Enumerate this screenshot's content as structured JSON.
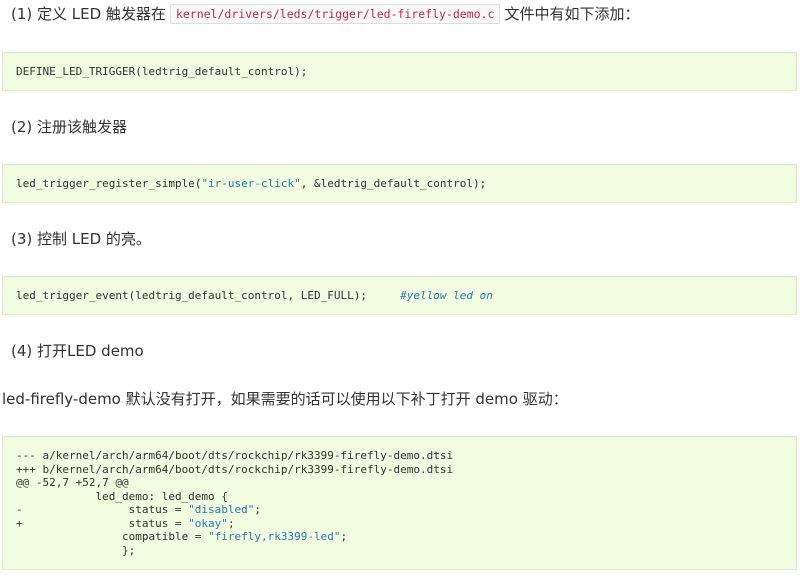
{
  "step1": {
    "prefix": "(1) 定义 LED 触发器在",
    "path": "kernel/drivers/leds/trigger/led-firefly-demo.c",
    "suffix": "文件中有如下添加："
  },
  "code1": "DEFINE_LED_TRIGGER(ledtrig_default_control);",
  "step2": "(2) 注册该触发器",
  "code2": {
    "before": "led_trigger_register_simple(",
    "string": "\"ir-user-click\"",
    "after": ", &ledtrig_default_control);"
  },
  "step3": "(3) 控制 LED 的亮。",
  "code3": {
    "code": "led_trigger_event(ledtrig_default_control, LED_FULL);     ",
    "comment": "#yellow led on"
  },
  "step4": "(4) 打开LED demo",
  "note": "led-firefly-demo 默认没有打开，如果需要的话可以使用以下补丁打开 demo 驱动：",
  "patch": {
    "line1": "--- a/kernel/arch/arm64/boot/dts/rockchip/rk3399-firefly-demo.dtsi",
    "line2": "+++ b/kernel/arch/arm64/boot/dts/rockchip/rk3399-firefly-demo.dtsi",
    "line3": "@@ -52,7 +52,7 @@",
    "line4": "            led_demo: led_demo {",
    "line5_pre": "-                status = ",
    "line5_str": "\"disabled\"",
    "line5_post": ";",
    "line6_pre": "+                status = ",
    "line6_str": "\"okay\"",
    "line6_post": ";",
    "line7_pre": "                compatible = ",
    "line7_str": "\"firefly,rk3399-led\"",
    "line7_post": ";",
    "line8": "                };"
  }
}
